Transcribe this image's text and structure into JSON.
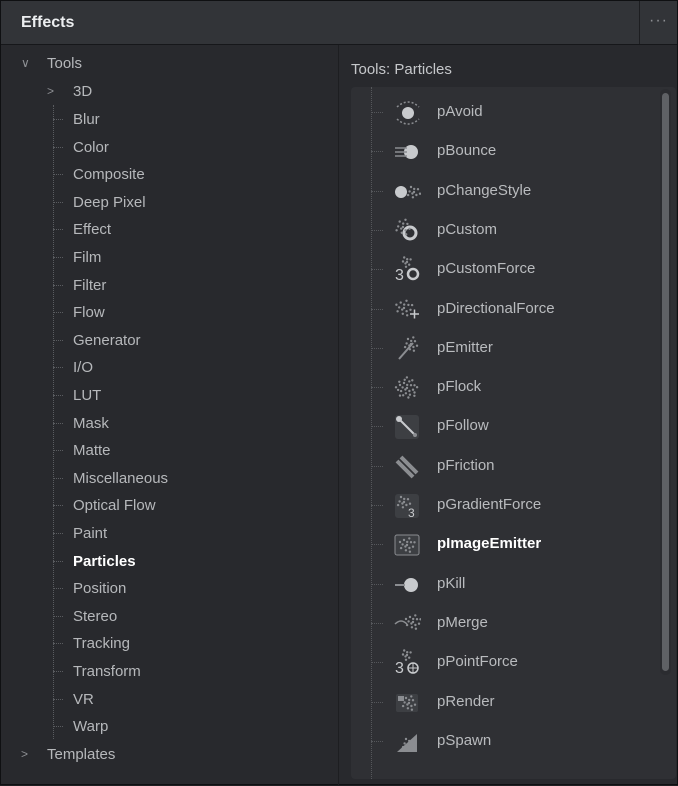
{
  "header": {
    "title": "Effects",
    "more": "···"
  },
  "tree": {
    "root_label": "Tools",
    "root_chevron": "∨",
    "child_3d": "3D",
    "child_3d_chevron": ">",
    "children": [
      "Blur",
      "Color",
      "Composite",
      "Deep Pixel",
      "Effect",
      "Film",
      "Filter",
      "Flow",
      "Generator",
      "I/O",
      "LUT",
      "Mask",
      "Matte",
      "Miscellaneous",
      "Optical Flow",
      "Paint",
      "Particles",
      "Position",
      "Stereo",
      "Tracking",
      "Transform",
      "VR",
      "Warp"
    ],
    "selected": "Particles",
    "templates_label": "Templates",
    "templates_chevron": ">"
  },
  "list": {
    "section_label": "Tools: Particles",
    "items": [
      "pAvoid",
      "pBounce",
      "pChangeStyle",
      "pCustom",
      "pCustomForce",
      "pDirectionalForce",
      "pEmitter",
      "pFlock",
      "pFollow",
      "pFriction",
      "pGradientForce",
      "pImageEmitter",
      "pKill",
      "pMerge",
      "pPointForce",
      "pRender",
      "pSpawn"
    ],
    "selected": "pImageEmitter"
  }
}
